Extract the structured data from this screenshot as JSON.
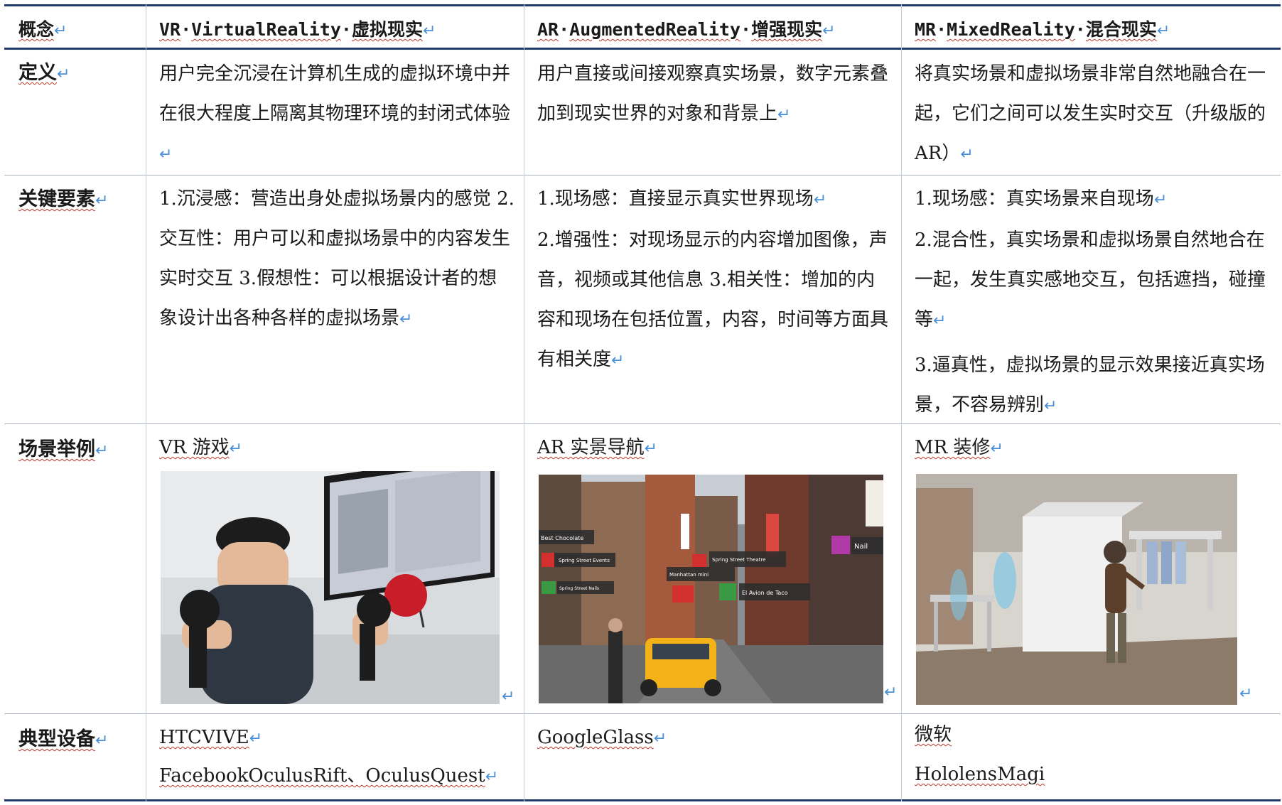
{
  "header": {
    "concept": "概念",
    "vr": {
      "abbr": "VR",
      "en": "VirtualReality",
      "zh": "虚拟现实"
    },
    "ar": {
      "abbr": "AR",
      "en": "AugmentedReality",
      "zh": "增强现实"
    },
    "mr": {
      "abbr": "MR",
      "en": "MixedReality",
      "zh": "混合现实"
    }
  },
  "rows": {
    "definition": {
      "label": "定义",
      "vr": "用户完全沉浸在计算机生成的虚拟环境中并在很大程度上隔离其物理环境的封闭式体验",
      "ar": "用户直接或间接观察真实场景，数字元素叠加到现实世界的对象和背景上",
      "mr": "将真实场景和虚拟场景非常自然地融合在一起，它们之间可以发生实时交互（升级版的 AR）"
    },
    "key_elements": {
      "label": "关键要素",
      "vr": "1.沉浸感：营造出身处虚拟场景内的感觉 2.交互性：用户可以和虚拟场景中的内容发生实时交互 3.假想性：可以根据设计者的想象设计出各种各样的虚拟场景",
      "ar": "1.现场感：直接显示真实世界现场",
      "ar2": "2.增强性：对现场显示的内容增加图像，声音，视频或其他信息 3.相关性：增加的内容和现场在包括位置，内容，时间等方面具有相关度",
      "mr": "1.现场感：真实场景来自现场",
      "mr2": "2.混合性，真实场景和虚拟场景自然地合在一起，发生真实感地交互，包括遮挡，碰撞等",
      "mr3": "3.逼真性，虚拟场景的显示效果接近真实场景，不容易辨别"
    },
    "example": {
      "label": "场景举例",
      "vr": "VR 游戏",
      "ar": "AR 实景导航",
      "mr": "MR 装修",
      "ar_overlay": [
        "Best Chocolate",
        "Spring Street Events",
        "Spring Street Theatre",
        "Manhattan mini",
        "Spring Street Nails",
        "El Avion de Taco",
        "Nail"
      ]
    },
    "devices": {
      "label": "典型设备",
      "vr1": "HTCVIVE",
      "vr2": "FacebookOculusRift、OculusQuest",
      "ar": "GoogleGlass",
      "mr1": "微软",
      "mr2": "HololensMagi"
    }
  },
  "colors": {
    "rule": "#1f3a6b",
    "mark": "#4a90d9",
    "squiggle": "#c0392b"
  }
}
